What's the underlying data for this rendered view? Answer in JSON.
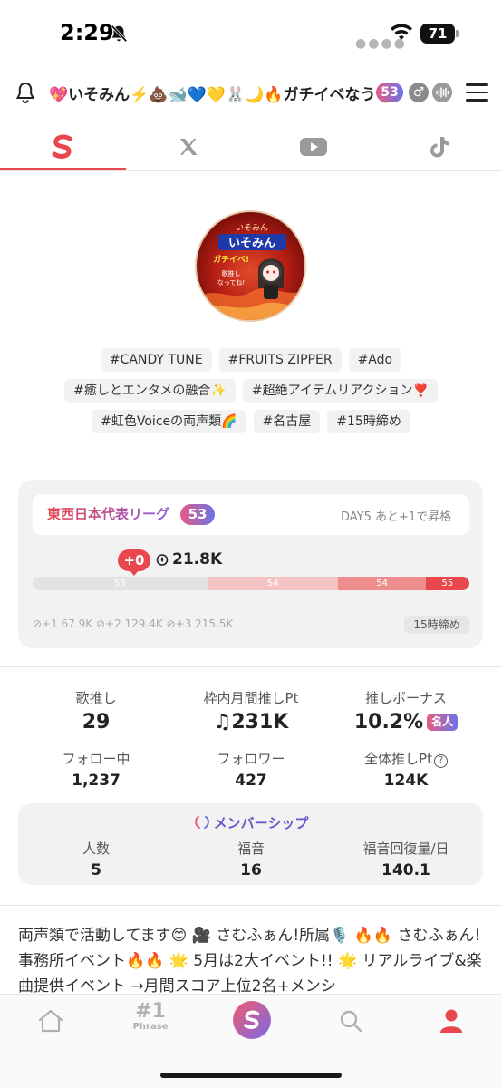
{
  "status_bar": {
    "time": "2:29",
    "battery": "71"
  },
  "header": {
    "title": "💖いそみん⚡️💩🐋💙💛🐰🌙🔥ガチイベなう🔥",
    "rank": "53",
    "gender": "♂"
  },
  "tabs": [
    {
      "name": "Singing app"
    },
    {
      "name": "X"
    },
    {
      "name": "YouTube"
    },
    {
      "name": "TikTok"
    }
  ],
  "profile": {
    "avatar_text": [
      "いそみん",
      "ガチイベ!",
      "歌推し",
      "なってね!"
    ]
  },
  "tags": [
    "#CANDY TUNE",
    "#FRUITS ZIPPER",
    "#Ado",
    "#癒しとエンタメの融合✨",
    "#超絶アイテムリアクション❣️",
    "#虹色Voiceの両声類🌈",
    "#名古屋",
    "#15時締め"
  ],
  "league": {
    "name": "東西日本代表リーグ",
    "rank": "53",
    "status": "DAY5 あと+1で昇格",
    "delta": "+0",
    "score": "21.8K",
    "segments": [
      {
        "label": "53",
        "fraction": 0.4,
        "color": "#e2e2e2"
      },
      {
        "label": "54",
        "fraction": 0.3,
        "color": "#f4c3c3"
      },
      {
        "label": "54",
        "fraction": 0.2,
        "color": "#ee8d8d"
      },
      {
        "label": "55",
        "fraction": 0.1,
        "color": "#e8474d"
      }
    ],
    "thresholds": "⊘+1 67.9K ⊘+2 129.4K ⊘+3 215.5K",
    "deadline": "15時締め"
  },
  "stats": {
    "song_label": "歌推し",
    "song_value": "29",
    "monthly_label": "枠内月間推しPt",
    "monthly_value": "♫231K",
    "bonus_label": "推しボーナス",
    "bonus_value": "10.2%",
    "bonus_badge": "名人",
    "following_label": "フォロー中",
    "following_value": "1,237",
    "followers_label": "フォロワー",
    "followers_value": "427",
    "total_label": "全体推しPt",
    "total_value": "124K"
  },
  "membership": {
    "title": "メンバーシップ",
    "count_label": "人数",
    "count_value": "5",
    "fukuon_label": "福音",
    "fukuon_value": "16",
    "recovery_label": "福音回復量/日",
    "recovery_value": "140.1"
  },
  "bio": "両声類で活動してます😊 🎥 さむふぁん!所属🎙️ 🔥🔥 さむふぁん!事務所イベント🔥🔥 🌟 5月は2大イベント!! 🌟 リアルライブ&楽曲提供イベント →月間スコア上位2名+メンシ",
  "bottom_nav": {
    "phrase_num": "#1",
    "phrase_label": "Phrase"
  }
}
